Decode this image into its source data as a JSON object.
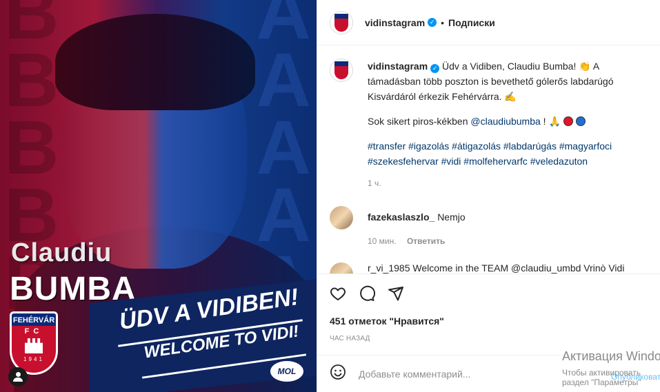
{
  "image": {
    "name_first": "Claudiu",
    "name_last": "BUMBA",
    "welcome_hu": "ÜDV A VIDIBEN!",
    "welcome_en": "WELCOME TO VIDI!",
    "crest_top": "FEHÉRVÁR",
    "crest_fc": "FC",
    "crest_year": "1941",
    "sponsor": "MOL",
    "bg_letters": "B A"
  },
  "header": {
    "username": "vidinstagram",
    "separator": "•",
    "follow_state": "Подписки"
  },
  "caption": {
    "username": "vidinstagram",
    "text_1": "Üdv a Vidiben, Claudiu Bumba! 👏 A támadásban több poszton is bevethető gólerős labdarúgó Kisvárdáról érkezik Fehérvárra. ✍️",
    "text_2_prefix": "Sok sikert piros-kékben ",
    "mention": "@claudiubumba",
    "text_2_suffix": " ! 🙏",
    "hashtags": "#transfer #igazolás #átigazolás #labdarúgás #magyarfoci #szekesfehervar #vidi #molfehervarfc #veledazuton",
    "time": "1 ч."
  },
  "comments": [
    {
      "username": "fazekaslaszlo_",
      "text": "Nemjo",
      "time": "10 мин.",
      "reply_label": "Ответить"
    },
    {
      "partial_text": "r_vi_1985 Welcome in the TEAM @claudiu_umbd Vrinò Vidi"
    }
  ],
  "actions": {
    "likes": "451 отметок \"Нравится\"",
    "time_ago": "ЧАС НАЗАД"
  },
  "comment_input": {
    "placeholder": "Добавьте комментарий..."
  },
  "watermark": {
    "line1": "Активация Windows",
    "line2": "Чтобы активировать",
    "line3": "раздел \"Параметры\"",
    "publish": "Опубликовать"
  },
  "colors": {
    "link": "#00376b",
    "verified": "#0095f6",
    "muted": "#8e8e8e",
    "red": "#c8102e",
    "blue": "#0b2a7a"
  }
}
